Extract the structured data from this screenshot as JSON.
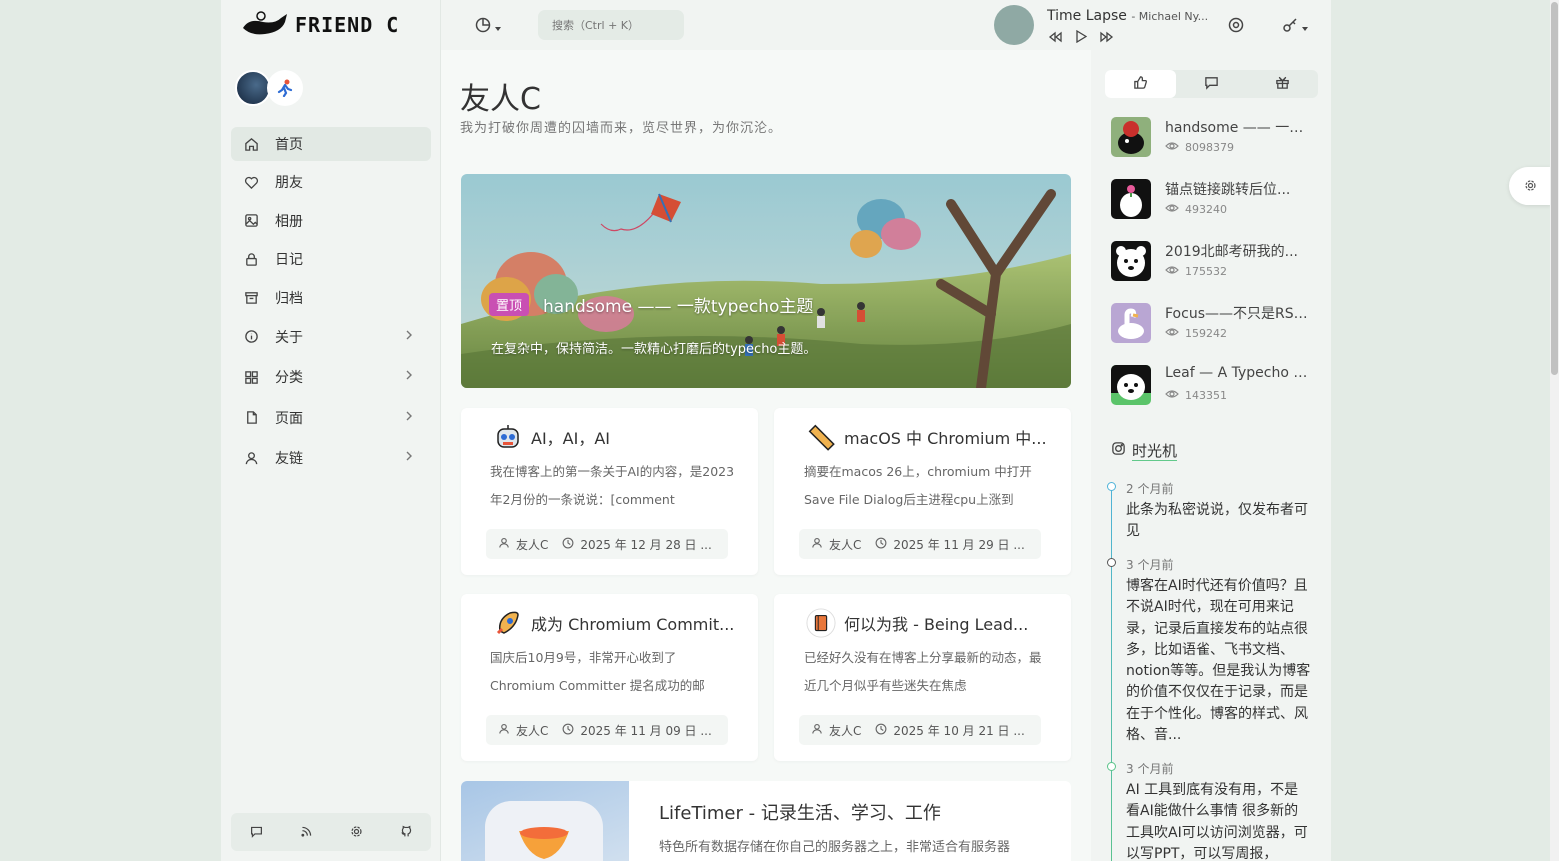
{
  "brand": {
    "logo_text": "FRIEND C"
  },
  "nav": {
    "items": [
      {
        "label": "首页",
        "icon": "home-icon",
        "active": true
      },
      {
        "label": "朋友",
        "icon": "heart-icon"
      },
      {
        "label": "相册",
        "icon": "image-icon"
      },
      {
        "label": "日记",
        "icon": "lock-icon"
      },
      {
        "label": "归档",
        "icon": "archive-icon"
      },
      {
        "label": "关于",
        "icon": "info-icon",
        "has_children": true
      },
      {
        "label": "分类",
        "icon": "grid-icon",
        "has_children": true
      },
      {
        "label": "页面",
        "icon": "file-icon",
        "has_children": true
      },
      {
        "label": "友链",
        "icon": "user-icon",
        "has_children": true
      }
    ],
    "footer_icons": [
      "comment-icon",
      "rss-icon",
      "settings-icon",
      "github-icon"
    ]
  },
  "header": {
    "search_placeholder": "搜索（Ctrl + K）",
    "music": {
      "title": "Time Lapse",
      "artist": "- Michael Ny..."
    }
  },
  "site": {
    "title": "友人C",
    "subtitle": "我为打破你周遭的囚墙而来，览尽世界，为你沉沦。"
  },
  "hero": {
    "badge": "置顶",
    "title": "handsome —— 一款typecho主题",
    "subtitle": "在复杂中，保持简洁。一款精心打磨后的typecho主题。"
  },
  "posts": [
    {
      "title": "AI，AI，AI",
      "excerpt": "我在博客上的第一条关于AI的内容，是2023年2月份的一条说说：[comment",
      "author": "友人C",
      "date": "2025 年 12 月 28 日 ..."
    },
    {
      "title": "macOS 中 Chromium 中...",
      "excerpt": "摘要在macos 26上，chromium 中打开Save File Dialog后主进程cpu上涨到",
      "author": "友人C",
      "date": "2025 年 11 月 29 日 ..."
    },
    {
      "title": "成为 Chromium Commit...",
      "excerpt": "国庆后10月9号，非常开心收到了Chromium Committer 提名成功的邮",
      "author": "友人C",
      "date": "2025 年 11 月 09 日 ..."
    },
    {
      "title": "何以为我 - Being Lead...",
      "excerpt": "已经好久没有在博客上分享最新的动态，最近几个月似乎有些迷失在焦虑",
      "author": "友人C",
      "date": "2025 年 10 月 21 日 ..."
    }
  ],
  "wide_post": {
    "title": "LifeTimer - 记录生活、学习、工作",
    "excerpt": "特色所有数据存储在你自己的服务器之上，非常适合有服务器"
  },
  "hot": [
    {
      "title": "handsome —— 一款t...",
      "views": "8098379"
    },
    {
      "title": "锚点链接跳转后位...",
      "views": "493240"
    },
    {
      "title": "2019北邮考研我的...",
      "views": "175532"
    },
    {
      "title": "Focus——不只是RSS...",
      "views": "159242"
    },
    {
      "title": "Leaf — A Typecho Th...",
      "views": "143351"
    }
  ],
  "timeline": {
    "title": "时光机",
    "items": [
      {
        "time": "2 个月前",
        "text": "此条为私密说说，仅发布者可见"
      },
      {
        "time": "3 个月前",
        "text": "博客在AI时代还有价值吗？且不说AI时代，现在可用来记录，记录后直接发布的站点很多，比如语雀、飞书文档、notion等等。但是我认为博客的价值不仅仅在于记录，而是在于个性化。博客的样式、风格、音..."
      },
      {
        "time": "3 个月前",
        "text": "AI 工具到底有没有用，不是看AI能做什么事情 很多新的工具吹AI可以访问浏览器，可以写PPT，可以写周报，"
      }
    ]
  }
}
